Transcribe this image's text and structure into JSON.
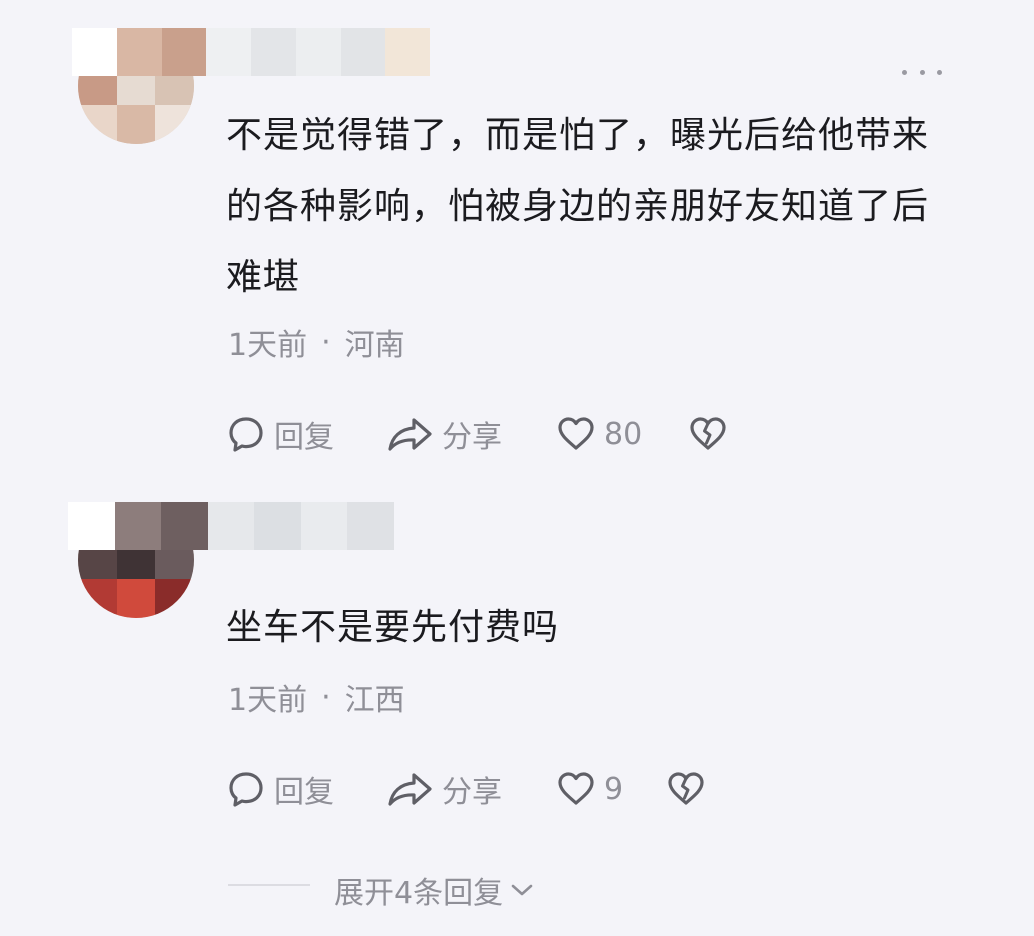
{
  "comments": [
    {
      "text": "不是觉得错了，而是怕了，曝光后给他带来的各种影响，怕被身边的亲朋好友知道了后难堪",
      "time": "1天前",
      "separator": "·",
      "location": "河南",
      "reply_label": "回复",
      "share_label": "分享",
      "like_count": "80"
    },
    {
      "text": "坐车不是要先付费吗",
      "time": "1天前",
      "separator": "·",
      "location": "江西",
      "reply_label": "回复",
      "share_label": "分享",
      "like_count": "9"
    }
  ],
  "expand_replies": {
    "label": "展开4条回复"
  },
  "icons": {
    "reply": "speech-bubble-icon",
    "share": "share-arrow-icon",
    "like": "heart-icon",
    "dislike": "broken-heart-icon",
    "more": "more-dots-icon",
    "expand": "chevron-down-icon"
  },
  "colors": {
    "background": "#f4f4f9",
    "text": "#1b1b1f",
    "secondary_text": "#8f8f97",
    "icon": "#5f5f66"
  }
}
